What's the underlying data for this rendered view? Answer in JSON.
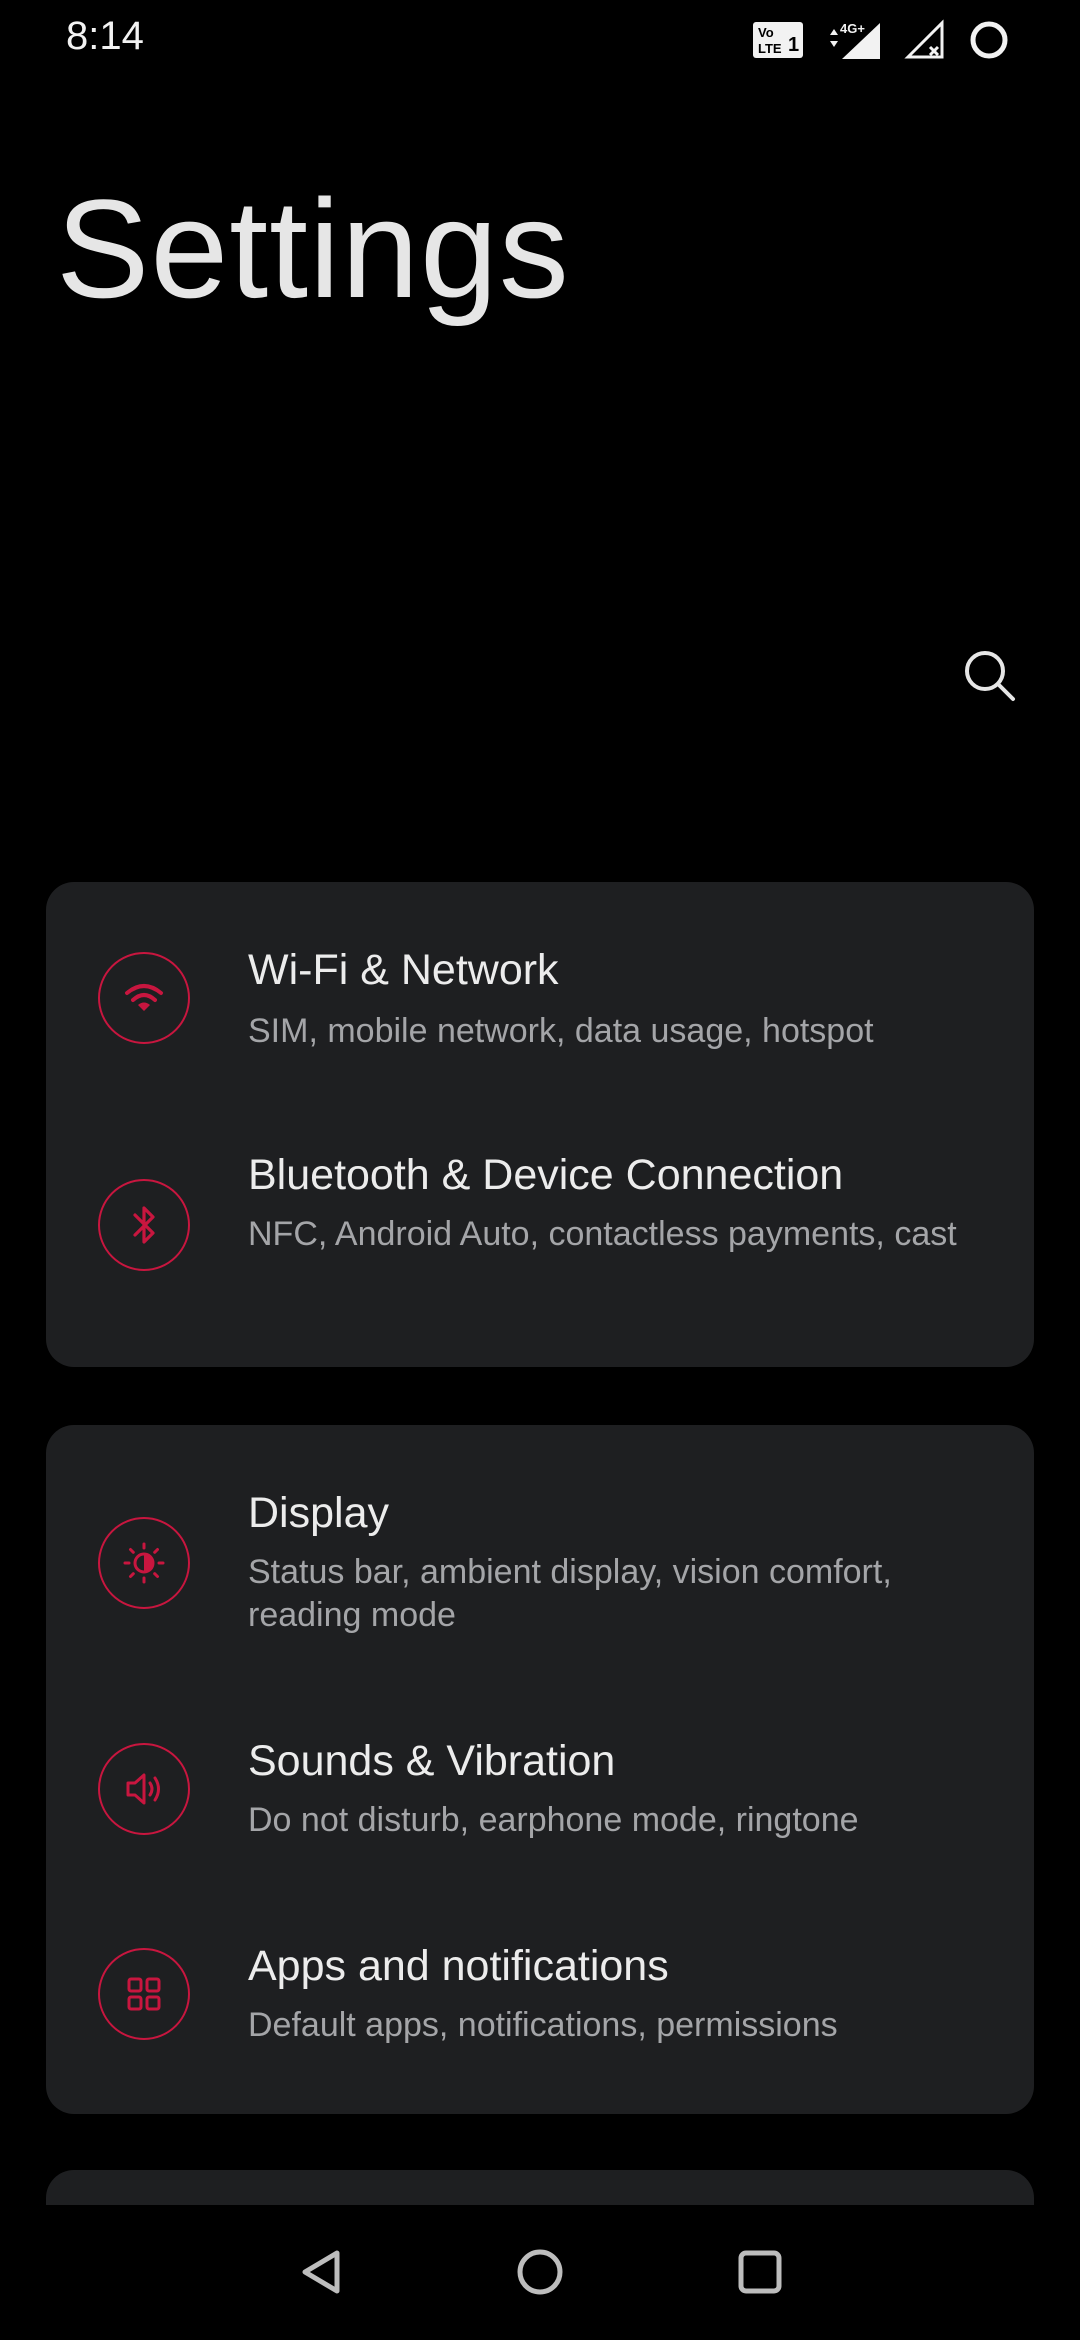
{
  "status_bar": {
    "time": "8:14",
    "icons": [
      "volte-lte-icon",
      "signal-4g-plus-icon",
      "signal-no-service-icon",
      "battery-ring-icon"
    ]
  },
  "page": {
    "title": "Settings",
    "search_icon": "search-icon"
  },
  "sections": [
    {
      "items": [
        {
          "title": "Wi-Fi & Network",
          "subtitle": "SIM, mobile network, data usage, hotspot",
          "icon": "wifi-icon"
        },
        {
          "title": "Bluetooth & Device Connection",
          "subtitle": "NFC, Android Auto, contactless payments, cast",
          "icon": "bluetooth-icon"
        }
      ]
    },
    {
      "items": [
        {
          "title": "Display",
          "subtitle": "Status bar, ambient display, vision comfort, reading mode",
          "icon": "brightness-icon"
        },
        {
          "title": "Sounds & Vibration",
          "subtitle": "Do not disturb, earphone mode, ringtone",
          "icon": "speaker-icon"
        },
        {
          "title": "Apps and notifications",
          "subtitle": "Default apps, notifications, permissions",
          "icon": "apps-grid-icon"
        }
      ]
    }
  ],
  "nav_bar": {
    "buttons": [
      "back-icon",
      "home-icon",
      "recents-icon"
    ]
  },
  "colors": {
    "accent": "#c8163f",
    "background": "#000000",
    "card": "#1e1f21",
    "title_text": "#ececec",
    "subtitle_text": "#a4a5a8"
  }
}
